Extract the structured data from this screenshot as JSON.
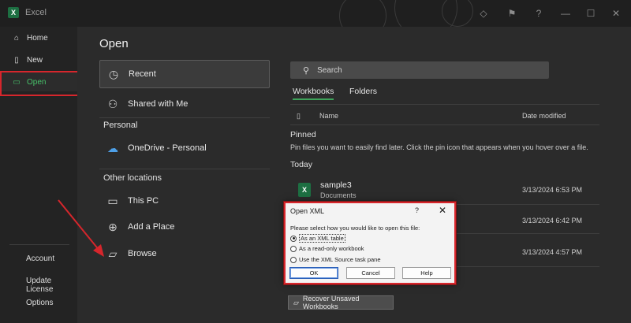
{
  "titlebar": {
    "app_name": "Excel",
    "help_label": "?"
  },
  "nav": {
    "items": [
      {
        "label": "Home",
        "icon": "home-icon"
      },
      {
        "label": "New",
        "icon": "new-file-icon"
      },
      {
        "label": "Open",
        "icon": "folder-open-icon",
        "active": true
      }
    ],
    "bottom": [
      "Account",
      "Update License",
      "Options"
    ]
  },
  "open": {
    "title": "Open",
    "recent": "Recent",
    "shared": "Shared with Me",
    "personal_heading": "Personal",
    "onedrive": "OneDrive - Personal",
    "other_heading": "Other locations",
    "this_pc": "This PC",
    "add_place": "Add a Place",
    "browse": "Browse"
  },
  "files": {
    "search_placeholder": "Search",
    "tabs": [
      "Workbooks",
      "Folders"
    ],
    "col_name": "Name",
    "col_date": "Date modified",
    "pinned_heading": "Pinned",
    "pinned_text": "Pin files you want to easily find later. Click the pin icon that appears when you hover over a file.",
    "today_heading": "Today",
    "rows": [
      {
        "name": "sample3",
        "location": "Documents",
        "date": "3/13/2024 6:53 PM"
      },
      {
        "date": "3/13/2024 6:42 PM"
      },
      {
        "date": "3/13/2024 4:57 PM"
      }
    ],
    "recover_label": "Recover Unsaved Workbooks"
  },
  "dialog": {
    "title": "Open XML",
    "help": "?",
    "close": "✕",
    "prompt": "Please select how you would like to open this file:",
    "options": [
      "As an XML table",
      "As a read-only workbook",
      "Use the XML Source task pane"
    ],
    "selected_option": 0,
    "ok": "OK",
    "cancel": "Cancel",
    "help_button": "Help"
  },
  "colors": {
    "accent_green": "#47c26a",
    "highlight_red": "#d6262c"
  }
}
